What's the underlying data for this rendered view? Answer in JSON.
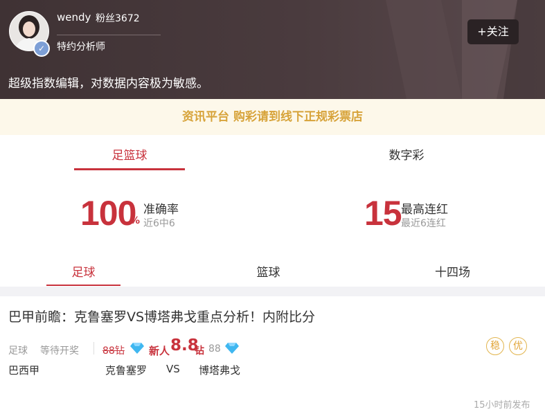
{
  "profile": {
    "username": "wendy",
    "fans": "粉丝3672",
    "role": "特约分析师",
    "follow_label": "+关注",
    "bio": "超级指数编辑，对数据内容极为敏感。"
  },
  "notice": "资讯平台 购彩请到线下正规彩票店",
  "category_tabs": [
    {
      "label": "足篮球",
      "active": true
    },
    {
      "label": "数字彩",
      "active": false
    }
  ],
  "stats": {
    "accuracy": {
      "value": "100",
      "unit": "%",
      "label": "准确率",
      "sub": "近6中6"
    },
    "streak": {
      "value": "15",
      "label": "最高连红",
      "sub": "最近6连红"
    }
  },
  "sport_tabs": [
    {
      "label": "足球",
      "active": true
    },
    {
      "label": "篮球",
      "active": false
    },
    {
      "label": "十四场",
      "active": false
    }
  ],
  "article": {
    "title": "巴甲前瞻：克鲁塞罗VS博塔弗戈重点分析！内附比分",
    "sport": "足球",
    "status": "等待开奖",
    "old_price": "88钻",
    "new_label": "新人",
    "new_price": "8.8",
    "new_unit": "钻",
    "price_count": "88",
    "badges": [
      "稳",
      "优"
    ],
    "league": "巴西甲",
    "home": "克鲁塞罗",
    "vs": "VS",
    "away": "博塔弗戈",
    "time": "15小时前发布"
  },
  "colors": {
    "accent": "#c8323c",
    "gold": "#d7a33a",
    "diamond": "#3fb7f0"
  }
}
